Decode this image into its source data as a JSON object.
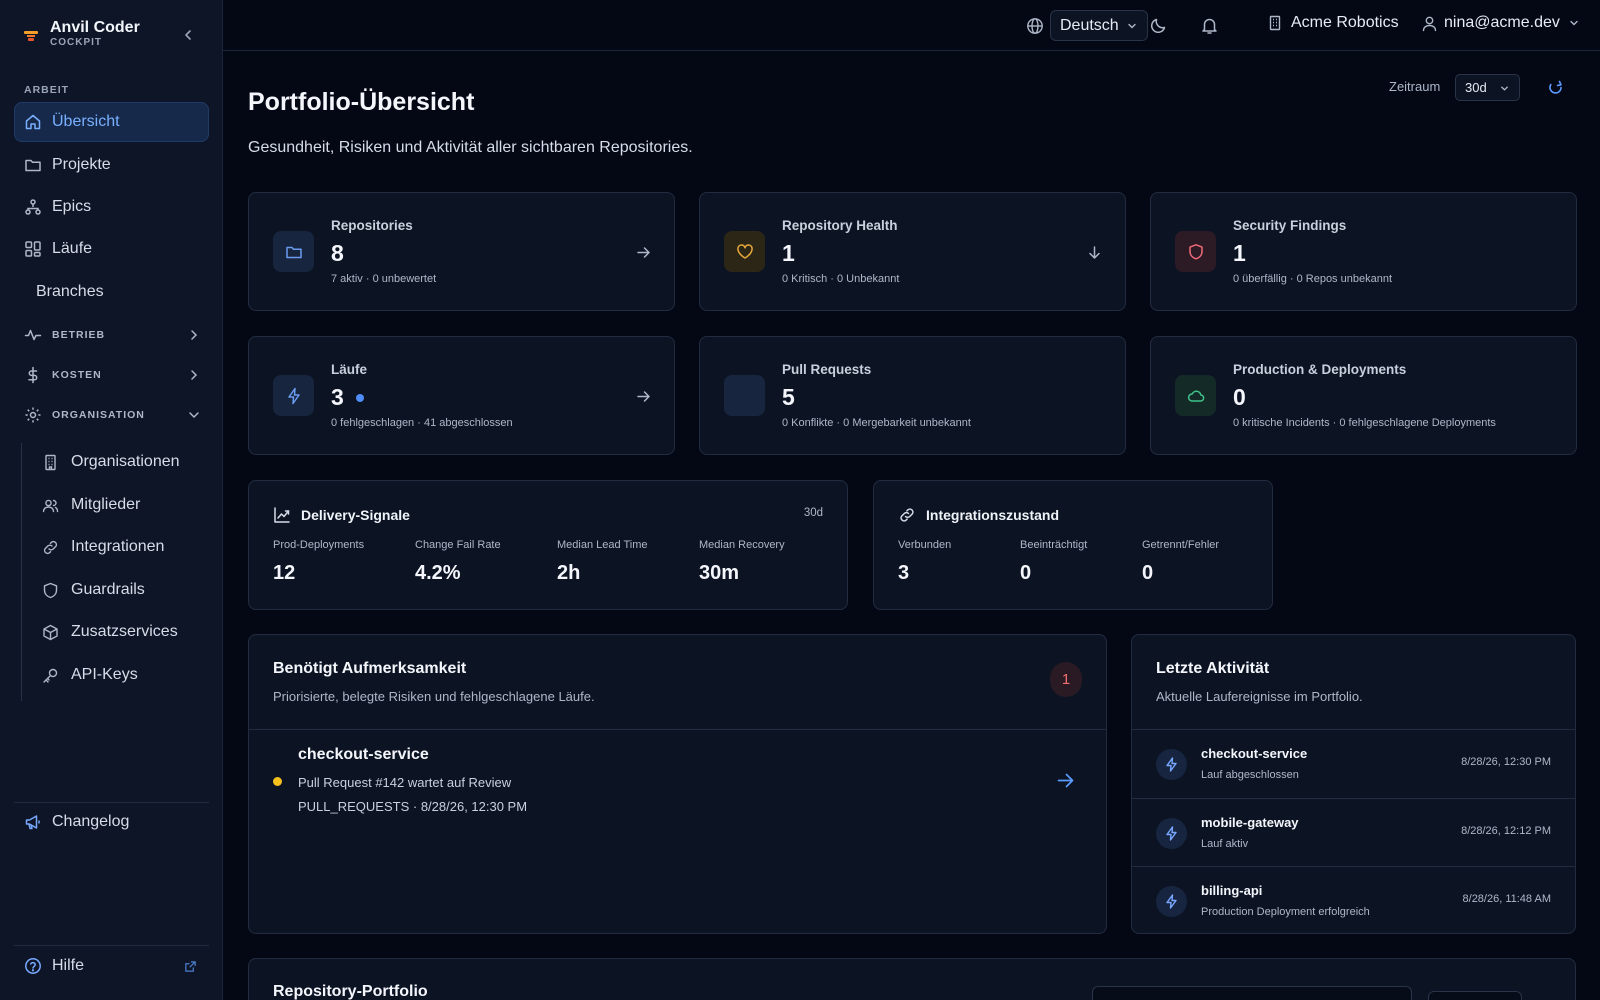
{
  "brand": {
    "name": "Anvil Coder",
    "subtitle": "COCKPIT"
  },
  "sidebar": {
    "section_work": "ARBEIT",
    "items": [
      {
        "label": "Übersicht",
        "icon": "home-icon",
        "active": true
      },
      {
        "label": "Projekte",
        "icon": "folder-icon"
      },
      {
        "label": "Epics",
        "icon": "hierarchy-icon"
      },
      {
        "label": "Läufe",
        "icon": "grid-icon"
      },
      {
        "label": "Branches",
        "icon": ""
      }
    ],
    "groups": [
      {
        "label": "BETRIEB",
        "icon": "activity-icon",
        "expanded": false
      },
      {
        "label": "KOSTEN",
        "icon": "dollar-icon",
        "expanded": false
      },
      {
        "label": "ORGANISATION",
        "icon": "gear-icon",
        "expanded": true
      }
    ],
    "org_items": [
      {
        "label": "Organisationen",
        "icon": "building-icon"
      },
      {
        "label": "Mitglieder",
        "icon": "users-icon"
      },
      {
        "label": "Integrationen",
        "icon": "link-icon"
      },
      {
        "label": "Guardrails",
        "icon": "shield-icon"
      },
      {
        "label": "Zusatzservices",
        "icon": "box-icon"
      },
      {
        "label": "API-Keys",
        "icon": "key-icon"
      }
    ],
    "changelog": "Changelog",
    "help": "Hilfe"
  },
  "topbar": {
    "language": "Deutsch",
    "organization": "Acme Robotics",
    "user": "nina@acme.dev"
  },
  "page": {
    "title": "Portfolio-Übersicht",
    "subtitle": "Gesundheit, Risiken und Aktivität aller sichtbaren Repositories.",
    "period_label": "Zeitraum",
    "period_value": "30d"
  },
  "stats": [
    {
      "label": "Repositories",
      "value": "8",
      "meta": "7 aktiv · 0 unbewertet",
      "icon": "folder-icon",
      "accent": "#5b8def"
    },
    {
      "label": "Repository Health",
      "value": "1",
      "meta": "0 Kritisch · 0 Unbekannt",
      "icon": "heart-icon",
      "accent": "#e8a93a"
    },
    {
      "label": "Security Findings",
      "value": "1",
      "meta": "0 überfällig · 0 Repos unbekannt",
      "icon": "shield-icon",
      "accent": "#f06a7a"
    },
    {
      "label": "Läufe",
      "value": "3",
      "meta": "0 fehlgeschlagen · 41 abgeschlossen",
      "icon": "bolt-icon",
      "accent": "#5b8def"
    },
    {
      "label": "Pull Requests",
      "value": "5",
      "meta": "0 Konflikte · 0 Mergebarkeit unbekannt",
      "icon": "",
      "accent": "#5b8def"
    },
    {
      "label": "Production & Deployments",
      "value": "0",
      "meta": "0 kritische Incidents · 0 fehlgeschlagene Deployments",
      "icon": "cloud-icon",
      "accent": "#3fc28a"
    }
  ],
  "delivery": {
    "title": "Delivery-Signale",
    "period": "30d",
    "metrics": [
      {
        "label": "Prod-Deployments",
        "value": "12"
      },
      {
        "label": "Change Fail Rate",
        "value": "4.2%"
      },
      {
        "label": "Median Lead Time",
        "value": "2h"
      },
      {
        "label": "Median Recovery",
        "value": "30m"
      }
    ]
  },
  "integrations": {
    "title": "Integrationszustand",
    "metrics": [
      {
        "label": "Verbunden",
        "value": "3"
      },
      {
        "label": "Beeinträchtigt",
        "value": "0"
      },
      {
        "label": "Getrennt/Fehler",
        "value": "0"
      }
    ]
  },
  "attention": {
    "title": "Benötigt Aufmerksamkeit",
    "subtitle": "Priorisierte, belegte Risiken und fehlgeschlagene Läufe.",
    "count": "1",
    "items": [
      {
        "name": "checkout-service",
        "description": "Pull Request #142 wartet auf Review",
        "meta": "PULL_REQUESTS · 8/28/26, 12:30 PM",
        "status_color": "#f5c01c"
      }
    ]
  },
  "activity": {
    "title": "Letzte Aktivität",
    "subtitle": "Aktuelle Laufereignisse im Portfolio.",
    "items": [
      {
        "name": "checkout-service",
        "description": "Lauf abgeschlossen",
        "time": "8/28/26, 12:30 PM"
      },
      {
        "name": "mobile-gateway",
        "description": "Lauf aktiv",
        "time": "8/28/26, 12:12 PM"
      },
      {
        "name": "billing-api",
        "description": "Production Deployment erfolgreich",
        "time": "8/28/26, 11:48 AM"
      }
    ]
  },
  "portfolio": {
    "title": "Repository-Portfolio"
  }
}
